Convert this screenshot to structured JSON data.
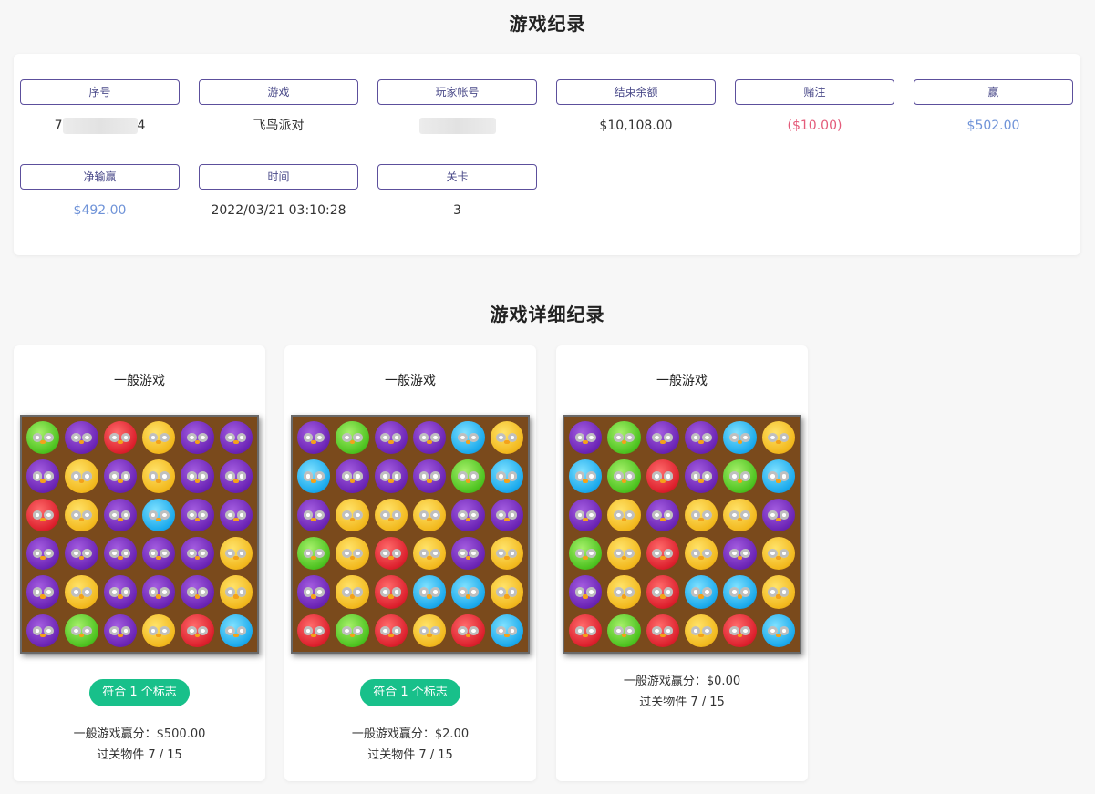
{
  "record": {
    "title": "游戏纪录",
    "fields": [
      {
        "label": "序号",
        "value_prefix": "7",
        "value_suffix": "4",
        "redacted": true
      },
      {
        "label": "游戏",
        "value": "飞鸟派对"
      },
      {
        "label": "玩家帐号",
        "redacted": true
      },
      {
        "label": "结束余额",
        "value": "$10,108.00"
      },
      {
        "label": "赌注",
        "value": "($10.00)",
        "color": "#e45b7a"
      },
      {
        "label": "赢",
        "value": "$502.00",
        "color": "#6f93d8"
      },
      {
        "label": "净输赢",
        "value": "$492.00",
        "color": "#6f93d8"
      },
      {
        "label": "时间",
        "value": "2022/03/21 03:10:28"
      },
      {
        "label": "关卡",
        "value": "3"
      }
    ]
  },
  "details": {
    "title": "游戏详细纪录",
    "cards": [
      {
        "title": "一般游戏",
        "tag": "符合 1 个标志",
        "score": "一般游戏赢分：$500.00",
        "progress": "过关物件 7 / 15",
        "board": [
          [
            "green",
            "purple",
            "red",
            "yellow",
            "purple",
            "purple"
          ],
          [
            "purple",
            "yellow",
            "purple",
            "yellow",
            "purple",
            "purple"
          ],
          [
            "red",
            "yellow",
            "purple",
            "blue",
            "purple",
            "purple"
          ],
          [
            "purple",
            "purple",
            "purple",
            "purple",
            "purple",
            "yellow"
          ],
          [
            "purple",
            "yellow",
            "purple",
            "purple",
            "purple",
            "yellow"
          ],
          [
            "purple",
            "green",
            "purple",
            "yellow",
            "red",
            "blue"
          ]
        ]
      },
      {
        "title": "一般游戏",
        "tag": "符合 1 个标志",
        "score": "一般游戏赢分：$2.00",
        "progress": "过关物件 7 / 15",
        "board": [
          [
            "purple",
            "green",
            "purple",
            "purple",
            "blue",
            "yellow"
          ],
          [
            "blue",
            "purple",
            "purple",
            "purple",
            "green",
            "blue"
          ],
          [
            "purple",
            "yellow",
            "yellow",
            "yellow",
            "purple",
            "purple"
          ],
          [
            "green",
            "yellow",
            "red",
            "yellow",
            "purple",
            "yellow"
          ],
          [
            "purple",
            "yellow",
            "red",
            "blue",
            "blue",
            "yellow"
          ],
          [
            "red",
            "green",
            "red",
            "yellow",
            "red",
            "blue"
          ]
        ]
      },
      {
        "title": "一般游戏",
        "score": "一般游戏赢分：$0.00",
        "progress": "过关物件 7 / 15",
        "board": [
          [
            "purple",
            "green",
            "purple",
            "purple",
            "blue",
            "yellow"
          ],
          [
            "blue",
            "green",
            "red",
            "purple",
            "green",
            "blue"
          ],
          [
            "purple",
            "yellow",
            "purple",
            "yellow",
            "yellow",
            "purple"
          ],
          [
            "green",
            "yellow",
            "red",
            "yellow",
            "purple",
            "yellow"
          ],
          [
            "purple",
            "yellow",
            "red",
            "blue",
            "blue",
            "yellow"
          ],
          [
            "red",
            "green",
            "red",
            "yellow",
            "red",
            "blue"
          ]
        ]
      }
    ]
  }
}
